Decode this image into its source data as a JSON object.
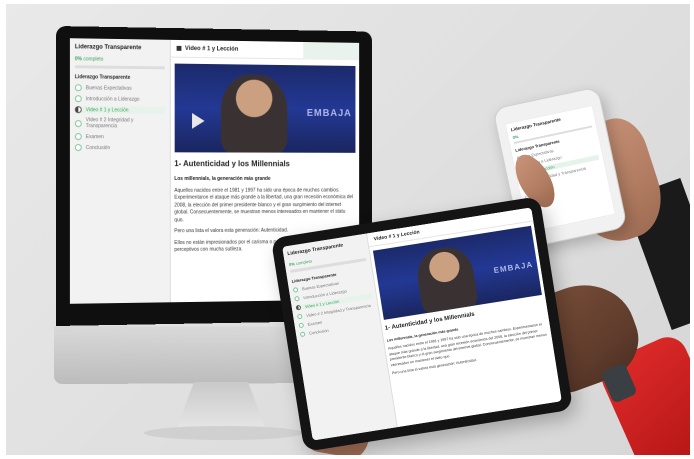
{
  "course_title": "Liderazgo Transparente",
  "progress_value": "0%",
  "progress_label": "completo",
  "section_label": "Liderazgo Transparente",
  "lesson_heading": "Video # 1 y Lección",
  "video_brand": "EMBAJA",
  "article_title": "1- Autenticidad y los Millennials",
  "article_subtitle": "Los millennials, la generación más grande",
  "article_p1": "Aquellos nacidos entre el 1981 y 1997 ha sido una época de muchos cambios. Experimentaron el ataque más grande a la libertad, una gran recesión económica del 2008, la elección del primer presidente blanco y el gran surgimiento del internet global. Consecuentemente, se muestran menos interesados en mantener el statu quo.",
  "article_p2": "Pero una lista el valora esta generación: Autenticidad.",
  "article_p3": "Ellos no están impresionados por el carisma o personalidad y tienden a ser más perceptivos con mucha sutileza.",
  "lesson_items": [
    "Buenas Expectativas",
    "Introducción a Liderazgo",
    "Video # 1 y Lección",
    "Video # 2 Integridad y Transparencia",
    "Examen",
    "Conclusión"
  ],
  "colors": {
    "accent_green": "#3aa35a",
    "video_blue": "#233894",
    "sleeve_red": "#e12b2b"
  }
}
